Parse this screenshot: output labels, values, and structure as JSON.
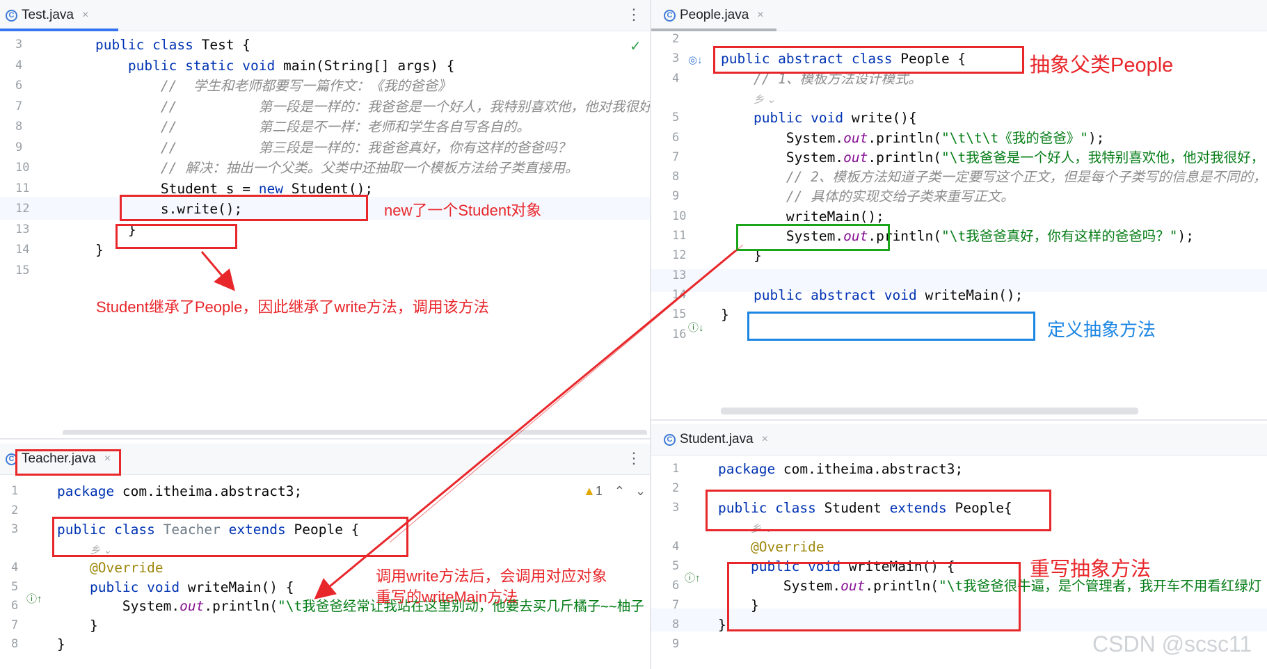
{
  "panes": {
    "test": {
      "tab": "Test.java",
      "lines": [
        {
          "n": "3",
          "html": "    <span class='kw'>public class</span> Test {"
        },
        {
          "n": "4",
          "html": "        <span class='kw'>public static void</span> main(String[] args) {"
        },
        {
          "n": "6",
          "html": "            <span class='cm'>//  学生和老师都要写一篇作文：《我的爸爸》</span>"
        },
        {
          "n": "7",
          "html": "            <span class='cm'>//          第一段是一样的：我爸爸是一个好人，我特别喜欢他，他对我很好，我</span>"
        },
        {
          "n": "8",
          "html": "            <span class='cm'>//          第二段是不一样：老师和学生各自写各自的。</span>"
        },
        {
          "n": "9",
          "html": "            <span class='cm'>//          第三段是一样的：我爸爸真好，你有这样的爸爸吗？</span>"
        },
        {
          "n": "10",
          "html": "            <span class='cm'>// 解决：抽出一个父类。父类中还抽取一个模板方法给子类直接用。</span>"
        },
        {
          "n": "11",
          "html": "            Student s = <span class='kw'>new</span> Student();"
        },
        {
          "n": "12",
          "html": "            s.write();"
        },
        {
          "n": "13",
          "html": "        }"
        },
        {
          "n": "14",
          "html": "    }"
        },
        {
          "n": "15",
          "html": ""
        }
      ]
    },
    "people": {
      "tab": "People.java",
      "lines": [
        {
          "n": "2",
          "html": ""
        },
        {
          "n": "3",
          "html": "<span class='kw'>public abstract class</span> People {"
        },
        {
          "n": "4",
          "html": "    <span class='cm'>// 1、模板方法设计模式。</span>"
        },
        {
          "n": "",
          "html": "    <span class='hint'>乡 ⌄</span>"
        },
        {
          "n": "5",
          "html": "    <span class='kw'>public void</span> write(){"
        },
        {
          "n": "6",
          "html": "        System.<span class='fld'>out</span>.println(<span class='st'>\"\\t\\t\\t《我的爸爸》\"</span>);"
        },
        {
          "n": "7",
          "html": "        System.<span class='fld'>out</span>.println(<span class='st'>\"\\t我爸爸是一个好人，我特别喜欢他，他对我很好，</span>"
        },
        {
          "n": "8",
          "html": "        <span class='cm'>// 2、模板方法知道子类一定要写这个正文，但是每个子类写的信息是不同的，</span>"
        },
        {
          "n": "9",
          "html": "        <span class='cm'>// 具体的实现交给子类来重写正文。</span>"
        },
        {
          "n": "10",
          "html": "        writeMain();"
        },
        {
          "n": "11",
          "html": "        System.<span class='fld'>out</span>.println(<span class='st'>\"\\t我爸爸真好，你有这样的爸爸吗？\"</span>);"
        },
        {
          "n": "12",
          "html": "    }"
        },
        {
          "n": "13",
          "html": ""
        },
        {
          "n": "14",
          "html": "    <span class='kw'>public abstract void</span> writeMain();"
        },
        {
          "n": "15",
          "html": "}"
        },
        {
          "n": "16",
          "html": ""
        }
      ]
    },
    "teacher": {
      "tab": "Teacher.java",
      "warning": "1",
      "lines": [
        {
          "n": "1",
          "html": "<span class='kw'>package</span> com.itheima.abstract3;"
        },
        {
          "n": "2",
          "html": ""
        },
        {
          "n": "3",
          "html": "<span class='kw'>public class</span> <span class='cls-dim'>Teacher</span> <span class='kw'>extends</span> People {"
        },
        {
          "n": "",
          "html": "    <span class='hint'>乡 ⌄</span>"
        },
        {
          "n": "4",
          "html": "    <span class='ann'>@Override</span>"
        },
        {
          "n": "5",
          "html": "    <span class='kw'>public void</span> writeMain() {"
        },
        {
          "n": "6",
          "html": "        System.<span class='fld'>out</span>.println(<span class='st'>\"\\t我爸爸经常让我站在这里别动，他要去买几斤橘子~~柚子</span>"
        },
        {
          "n": "7",
          "html": "    }"
        },
        {
          "n": "8",
          "html": "}"
        }
      ]
    },
    "student": {
      "tab": "Student.java",
      "lines": [
        {
          "n": "1",
          "html": "<span class='kw'>package</span> com.itheima.abstract3;"
        },
        {
          "n": "2",
          "html": ""
        },
        {
          "n": "3",
          "html": "<span class='kw'>public class</span> Student <span class='kw'>extends</span> People{"
        },
        {
          "n": "",
          "html": "    <span class='hint'>乡 ⌄</span>"
        },
        {
          "n": "4",
          "html": "    <span class='ann'>@Override</span>"
        },
        {
          "n": "5",
          "html": "    <span class='kw'>public void</span> writeMain() {"
        },
        {
          "n": "6",
          "html": "        System.<span class='fld'>out</span>.println(<span class='st'>\"\\t我爸爸很牛逼，是个管理者，我开车不用看红绿灯</span>"
        },
        {
          "n": "7",
          "html": "    }"
        },
        {
          "n": "8",
          "html": "}"
        },
        {
          "n": "9",
          "html": ""
        }
      ]
    }
  },
  "annotations": {
    "new_student": "new了一个Student对象",
    "inherit_write": "Student继承了People，因此继承了write方法，调用该方法",
    "abstract_parent": "抽象父类People",
    "define_abstract": "定义抽象方法",
    "call_write_line1": "调用write方法后，会调用对应对象",
    "call_write_line2": "重写的writeMain方法",
    "override_abstract": "重写抽象方法"
  },
  "watermark": "CSDN @scsc11",
  "colors": {
    "annotation_red": "#e8272b",
    "annotation_green": "#1ba51b",
    "annotation_blue": "#1c86e3",
    "keyword": "#0033b3"
  }
}
